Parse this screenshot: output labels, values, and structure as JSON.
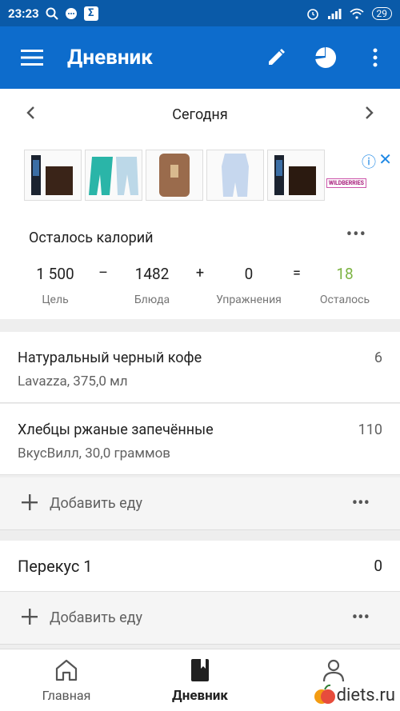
{
  "status_bar": {
    "time": "23:23",
    "battery": "29"
  },
  "app_bar": {
    "title": "Дневник"
  },
  "date_bar": {
    "date": "Сегодня"
  },
  "ad": {
    "brand": "WILDBERRIES"
  },
  "calories": {
    "title": "Осталось калорий",
    "goal_value": "1 500",
    "goal_label": "Цель",
    "food_value": "1482",
    "food_label": "Блюда",
    "exercise_value": "0",
    "exercise_label": "Упражнения",
    "remaining_value": "18",
    "remaining_label": "Осталось",
    "op_minus": "–",
    "op_plus": "+",
    "op_equals": "=",
    "remaining_color": "#7cb342"
  },
  "foods": [
    {
      "name": "Натуральный черный кофе",
      "desc": "Lavazza, 375,0 мл",
      "cal": "6"
    },
    {
      "name": "Хлебцы ржаные запечённые",
      "desc": "ВкусВилл, 30,0 граммов",
      "cal": "110"
    }
  ],
  "add_food_label": "Добавить еду",
  "snack": {
    "name": "Перекус 1",
    "cal": "0"
  },
  "bottom_nav": {
    "home": "Главная",
    "diary": "Дневник",
    "profile": ""
  },
  "watermark": {
    "text": "diets.ru"
  },
  "colors": {
    "primary": "#0d6ccc",
    "status": "#0a5aa8",
    "accent_green": "#7cb342"
  }
}
